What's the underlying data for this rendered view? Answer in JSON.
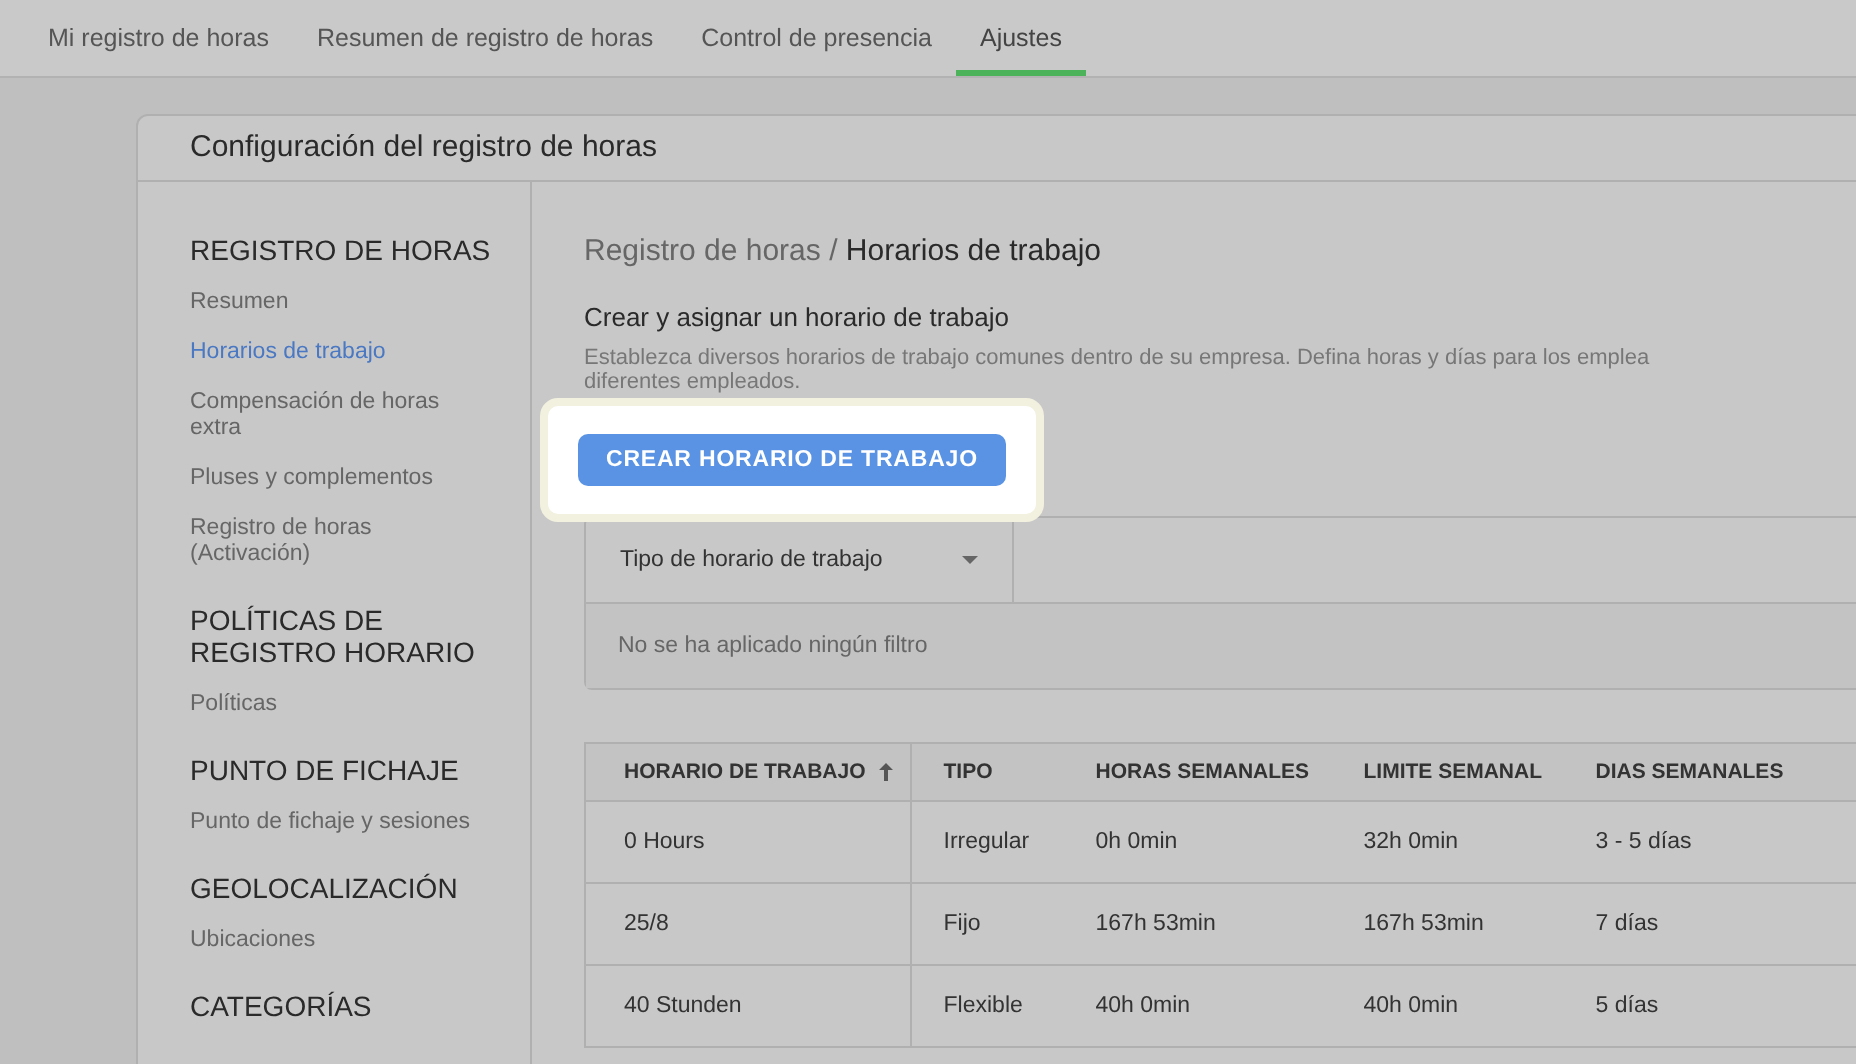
{
  "tabs": [
    {
      "label": "Mi registro de horas",
      "selected": false
    },
    {
      "label": "Resumen de registro de horas",
      "selected": false
    },
    {
      "label": "Control de presencia",
      "selected": false
    },
    {
      "label": "Ajustes",
      "selected": true
    }
  ],
  "card": {
    "title": "Configuración del registro de horas"
  },
  "sidebar": {
    "sections": [
      {
        "heading": "REGISTRO DE HORAS",
        "items": [
          {
            "label": "Resumen",
            "selected": false
          },
          {
            "label": "Horarios de trabajo",
            "selected": true
          },
          {
            "label": "Compensación de horas extra",
            "selected": false
          },
          {
            "label": "Pluses y complementos",
            "selected": false
          },
          {
            "label": "Registro de horas (Activación)",
            "selected": false
          }
        ]
      },
      {
        "heading": "POLÍTICAS DE REGISTRO HORARIO",
        "items": [
          {
            "label": "Políticas",
            "selected": false
          }
        ]
      },
      {
        "heading": "PUNTO DE FICHAJE",
        "items": [
          {
            "label": "Punto de fichaje y sesiones",
            "selected": false
          }
        ]
      },
      {
        "heading": "GEOLOCALIZACIÓN",
        "items": [
          {
            "label": "Ubicaciones",
            "selected": false
          }
        ]
      },
      {
        "heading": "CATEGORÍAS"
      }
    ]
  },
  "breadcrumb": {
    "parent": "Registro de horas",
    "separator": "/",
    "current": "Horarios de trabajo"
  },
  "section": {
    "title": "Crear y asignar un horario de trabajo",
    "description_lines": [
      "Establezca diversos horarios de trabajo comunes dentro de su empresa. Defina horas y días para los emplea",
      "diferentes empleados."
    ]
  },
  "create_button": {
    "label": "CREAR HORARIO DE TRABAJO"
  },
  "filter": {
    "dropdown": "Tipo de horario de trabajo",
    "status": "No se ha aplicado ningún filtro"
  },
  "table": {
    "columns": [
      {
        "label": "HORARIO DE TRABAJO",
        "sorted": true
      },
      {
        "label": "TIPO",
        "sorted": false
      },
      {
        "label": "HORAS SEMANALES",
        "sorted": false
      },
      {
        "label": "LIMITE SEMANAL",
        "sorted": false
      },
      {
        "label": "DIAS SEMANALES",
        "sorted": false
      }
    ],
    "rows": [
      [
        "0 Hours",
        "Irregular",
        "0h 0min",
        "32h 0min",
        "3 - 5 días"
      ],
      [
        "25/8",
        "Fijo",
        "167h 53min",
        "167h 53min",
        "7 días"
      ],
      [
        "40 Stunden",
        "Flexible",
        "40h 0min",
        "40h 0min",
        "5 días"
      ]
    ]
  }
}
